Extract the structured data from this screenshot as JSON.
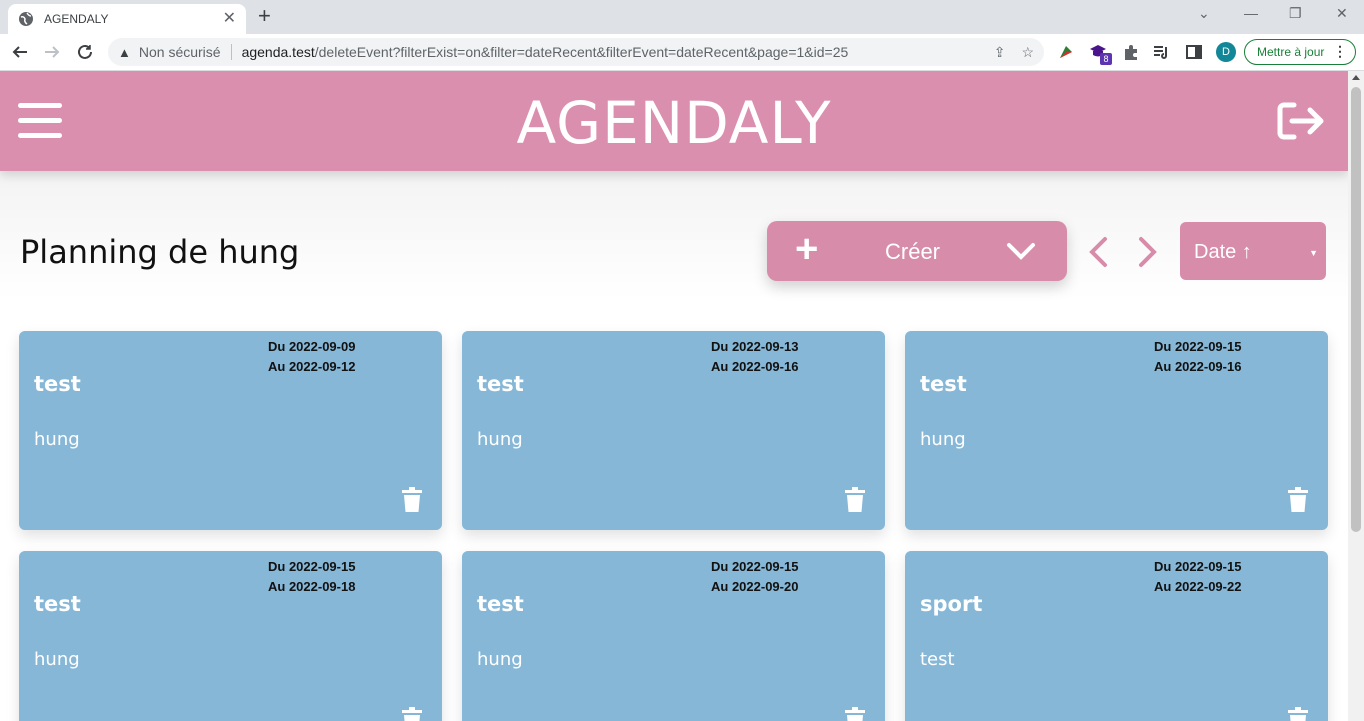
{
  "browser": {
    "tab_title": "AGENDALY",
    "new_tab": "+",
    "security_label": "Non sécurisé",
    "url_host": "agenda.test",
    "url_path": "/deleteEvent?filterExist=on&filter=dateRecent&filterEvent=dateRecent&page=1&id=25",
    "extension_badge": "8",
    "profile_initial": "D",
    "update_label": "Mettre à jour"
  },
  "header": {
    "brand": "AGENDALY"
  },
  "planning": {
    "title": "Planning de hung",
    "create_label": "Créer",
    "sort_value": "Date ↑"
  },
  "events": [
    {
      "from": "Du 2022-09-09",
      "to": "Au 2022-09-12",
      "title": "test",
      "owner": "hung"
    },
    {
      "from": "Du 2022-09-13",
      "to": "Au 2022-09-16",
      "title": "test",
      "owner": "hung"
    },
    {
      "from": "Du 2022-09-15",
      "to": "Au 2022-09-16",
      "title": "test",
      "owner": "hung"
    },
    {
      "from": "Du 2022-09-15",
      "to": "Au 2022-09-18",
      "title": "test",
      "owner": "hung"
    },
    {
      "from": "Du 2022-09-15",
      "to": "Au 2022-09-20",
      "title": "test",
      "owner": "hung"
    },
    {
      "from": "Du 2022-09-15",
      "to": "Au 2022-09-22",
      "title": "sport",
      "owner": "test"
    }
  ],
  "colors": {
    "header": "#db8fae",
    "button": "#d78ca9",
    "card": "#86b7d6"
  }
}
